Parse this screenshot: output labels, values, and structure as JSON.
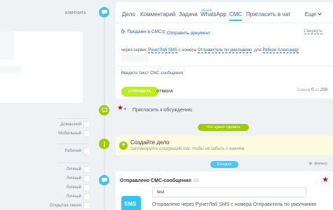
{
  "left_panel": {
    "change_link": "изменить",
    "labels": [
      "Домашний",
      "Мобильный",
      "Рабочий",
      "Личный",
      "Личный",
      "Личный",
      "Личный",
      "Открытая линия"
    ]
  },
  "composer": {
    "tabs": [
      {
        "label": "Дело",
        "badge": ""
      },
      {
        "label": "Комментарий",
        "badge": ""
      },
      {
        "label": "Задача",
        "badge": ""
      },
      {
        "label": "WhatsApp",
        "badge": "НОВОЕ"
      },
      {
        "label": "СМС",
        "badge": ""
      },
      {
        "label": "Пригласить в чат",
        "badge": ""
      }
    ],
    "active_tab": "СМС",
    "more_label": "Еще",
    "toolbar": {
      "sales_label": "Продажи в СМС",
      "send_doc_label": "Отправить документ",
      "collapse_label": "Свернуть"
    },
    "via": {
      "prefix": "через сервис",
      "service": "РунетЛаб SMS",
      "from_text": "с номера",
      "sender": "Отправитель по умолчанию",
      "to_text": "для",
      "recipient": "Рябков Александр"
    },
    "placeholder": "Введите текст СМС-сообщения",
    "send_label": "отправить",
    "cancel_label": "отмена",
    "counter": {
      "prefix": "Знаков",
      "count": "0",
      "of": "из",
      "max": "200"
    }
  },
  "invite": {
    "label": "Пригласить к обсуждению"
  },
  "todo_pill": "Что нужно сделать",
  "task": {
    "title": "Создайте дело",
    "subtitle": "Запланируйте следующий шаг, чтобы не забыть о важном"
  },
  "today_pill": "Сегодня",
  "filter_label": "фильтр",
  "entry": {
    "title": "Отправлено СМС-сообщение",
    "time": "11:55",
    "icon_text": "SMS",
    "message": "test",
    "description": "Отправлено через РунетЛаб SMS с номера Отправитель по умолчанию"
  }
}
